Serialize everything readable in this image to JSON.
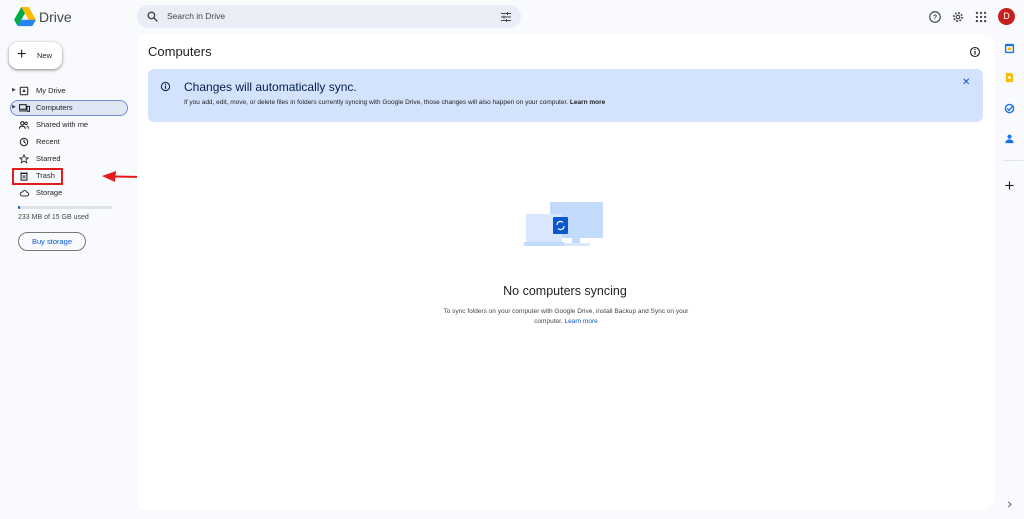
{
  "app": {
    "name": "Drive"
  },
  "search": {
    "placeholder": "Search in Drive"
  },
  "header": {
    "avatar_initial": "D"
  },
  "sidebar": {
    "new_label": "New",
    "items": [
      {
        "label": "My Drive"
      },
      {
        "label": "Computers"
      },
      {
        "label": "Shared with me"
      },
      {
        "label": "Recent"
      },
      {
        "label": "Starred"
      },
      {
        "label": "Trash"
      },
      {
        "label": "Storage"
      }
    ],
    "storage_used": "233 MB of 15 GB used",
    "storage_fraction": 0.016,
    "buy_storage": "Buy storage"
  },
  "main": {
    "title": "Computers",
    "banner": {
      "title": "Changes will automatically sync.",
      "body": "If you add, edit, move, or delete files in folders currently syncing with Google Drive, those changes will also happen on your computer.",
      "link": "Learn more"
    },
    "empty": {
      "title": "No computers syncing",
      "desc_line1": "To sync folders on your computer with Google Drive, install Backup and Sync on your",
      "desc_line2": "computer.",
      "link": "Learn more"
    }
  },
  "colors": {
    "accent": "#0b57d0",
    "highlight": "#e21b1b",
    "banner": "#d3e3fd"
  },
  "icons": [
    "drive-logo-icon",
    "search-icon",
    "filter-icon",
    "help-icon",
    "settings-icon",
    "apps-grid-icon",
    "info-icon",
    "close-icon",
    "calendar-icon",
    "keep-icon",
    "tasks-icon",
    "contacts-icon",
    "add-icon",
    "chevron-right-icon"
  ]
}
